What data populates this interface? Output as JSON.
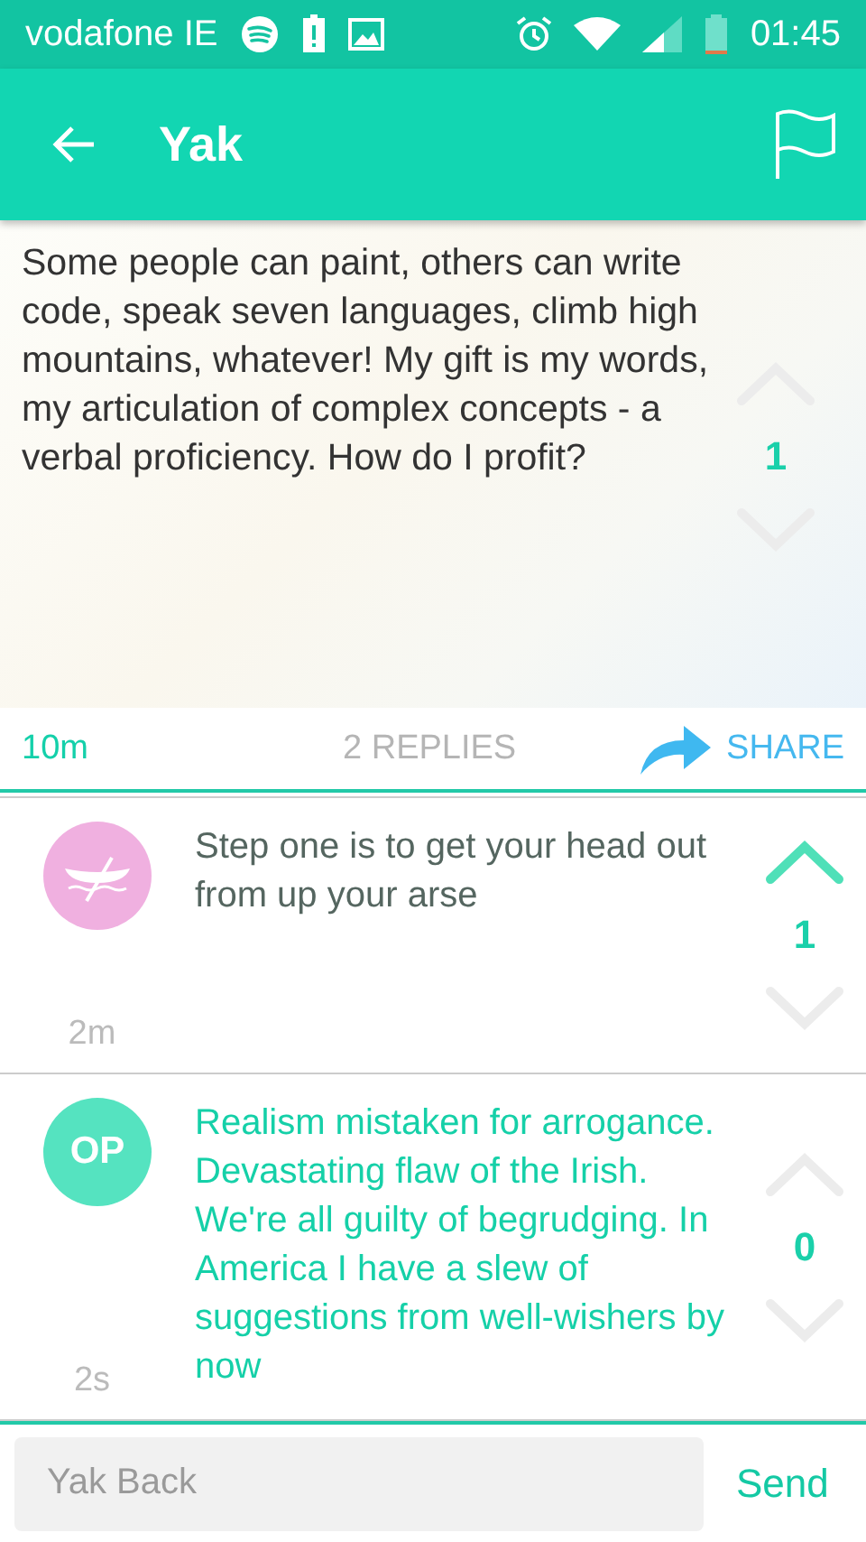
{
  "status_bar": {
    "carrier": "vodafone IE",
    "time": "01:45"
  },
  "toolbar": {
    "title": "Yak"
  },
  "post": {
    "text": "Some people can paint, others can write code, speak seven languages, climb high mountains, whatever! My gift is my words, my articulation of complex concepts - a verbal proficiency. How do I profit?",
    "score": "1",
    "upvoted": false,
    "age": "10m",
    "replies": "2 REPLIES",
    "share": "SHARE"
  },
  "replies": [
    {
      "avatar": {
        "kind": "boat",
        "color": "#f0b0e0"
      },
      "text": "Step one is to get your head out from up your arse",
      "op": false,
      "score": "1",
      "upvoted": true,
      "age": "2m"
    },
    {
      "avatar": {
        "kind": "label",
        "label": "OP",
        "color": "#55e3c0"
      },
      "text": "Realism mistaken for arrogance. Devastating flaw of the Irish. We're all guilty of begrudging. In America I have a slew of suggestions from well-wishers by now",
      "op": true,
      "score": "0",
      "upvoted": false,
      "age": "2s"
    }
  ],
  "composer": {
    "placeholder": "Yak Back",
    "send": "Send"
  }
}
